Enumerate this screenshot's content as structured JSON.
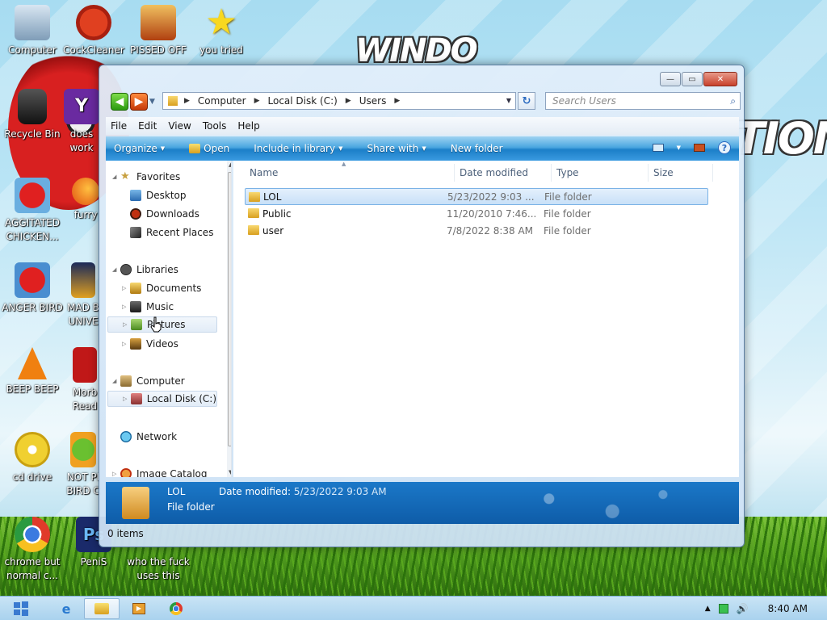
{
  "desktop": {
    "background_title_top": "WINDO",
    "background_title_bottom": "TION",
    "icons": [
      {
        "label": "Computer",
        "icon": "computer-icon"
      },
      {
        "label": "CockCleaner",
        "icon": "cleaner-icon"
      },
      {
        "label": "PISSED OFF",
        "icon": "angry-bird-seasons-icon"
      },
      {
        "label": "you tried",
        "icon": "star-icon"
      },
      {
        "label": "Recycle Bin",
        "icon": "recycle-bin-icon"
      },
      {
        "label": "does work",
        "icon": "yahoo-icon"
      },
      {
        "label": "AGGITATED CHICKEN...",
        "icon": "angry-bird-icon"
      },
      {
        "label": "furry",
        "icon": "firefox-icon"
      },
      {
        "label": "ANGER BIRD",
        "icon": "angry-bird-icon"
      },
      {
        "label": "MAD B UNIVE",
        "icon": "angry-bird-space-icon"
      },
      {
        "label": "BEEP BEEP",
        "icon": "vlc-icon"
      },
      {
        "label": "Morb Read",
        "icon": "pdf-reader-icon"
      },
      {
        "label": "cd drive",
        "icon": "cd-drive-icon"
      },
      {
        "label": "NOT PI BIRD C",
        "icon": "bad-piggies-icon"
      },
      {
        "label": "chrome but normal c...",
        "icon": "chrome-icon"
      },
      {
        "label": "PeniS",
        "icon": "photoshop-icon"
      },
      {
        "label": "who the fuck uses this",
        "icon": "app-icon"
      }
    ]
  },
  "window": {
    "controls": {
      "minimize": "—",
      "maximize": "▭",
      "close": "✕"
    },
    "breadcrumb": [
      "Computer",
      "Local Disk (C:)",
      "Users"
    ],
    "search_placeholder": "Search Users",
    "menu": [
      "File",
      "Edit",
      "View",
      "Tools",
      "Help"
    ],
    "commands": [
      "Organize",
      "Open",
      "Include in library",
      "Share with",
      "New folder"
    ],
    "nav_pane": {
      "favorites": {
        "label": "Favorites",
        "items": [
          "Desktop",
          "Downloads",
          "Recent Places"
        ]
      },
      "libraries": {
        "label": "Libraries",
        "items": [
          "Documents",
          "Music",
          "Pictures",
          "Videos"
        ]
      },
      "computer": {
        "label": "Computer",
        "items": [
          "Local Disk (C:)"
        ]
      },
      "network": {
        "label": "Network"
      },
      "image_catalog": {
        "label": "Image Catalog"
      }
    },
    "columns": [
      "Name",
      "Date modified",
      "Type",
      "Size"
    ],
    "files": [
      {
        "name": "LOL",
        "date": "5/23/2022 9:03 ...",
        "type": "File folder",
        "selected": true
      },
      {
        "name": "Public",
        "date": "11/20/2010 7:46...",
        "type": "File folder",
        "selected": false
      },
      {
        "name": "user",
        "date": "7/8/2022 8:38 AM",
        "type": "File folder",
        "selected": false
      }
    ],
    "details": {
      "name": "LOL",
      "type": "File folder",
      "date_label": "Date modified:",
      "date_value": "5/23/2022 9:03 AM"
    },
    "status": "0 items"
  },
  "taskbar": {
    "clock": "8:40 AM",
    "items": [
      "start-icon",
      "internet-explorer-icon",
      "explorer-icon",
      "media-player-icon",
      "chrome-icon"
    ],
    "tray": [
      "tray-up-arrow-icon",
      "battery-icon",
      "volume-icon"
    ]
  },
  "colors": {
    "command_bar": "#1c7fc8",
    "details_pane": "#0e5ca8",
    "selection": "#c8e0f8",
    "close_button": "#c8412c"
  }
}
